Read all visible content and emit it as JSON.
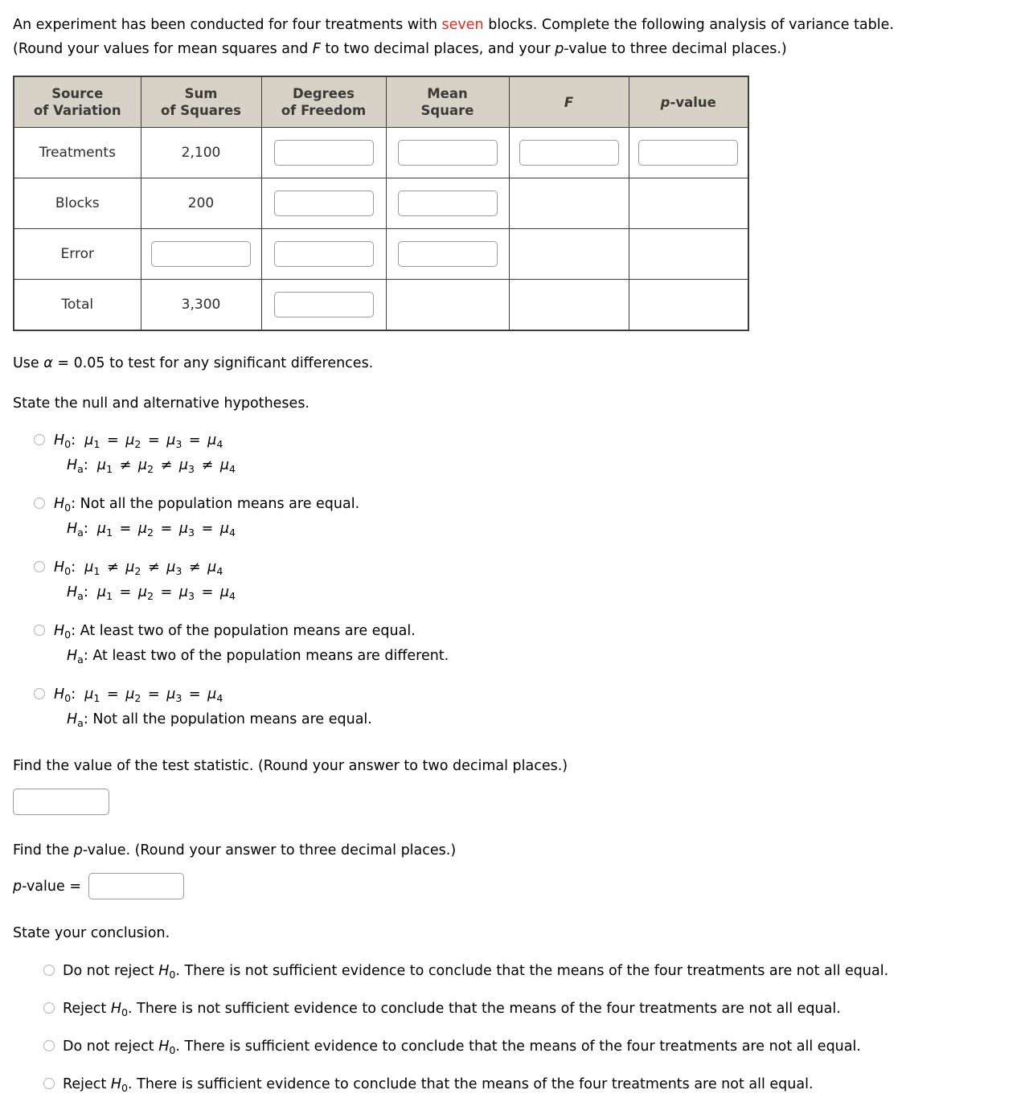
{
  "intro": {
    "part1": "An experiment has been conducted for four treatments with ",
    "highlight": "seven",
    "part2": " blocks. Complete the following analysis of variance table.",
    "line2_a": "(Round your values for mean squares and ",
    "line2_f": "F",
    "line2_b": " to two decimal places, and your ",
    "line2_p": "p",
    "line2_c": "-value to three decimal places.)"
  },
  "table": {
    "headers": {
      "source_l1": "Source",
      "source_l2": "of Variation",
      "ss_l1": "Sum",
      "ss_l2": "of Squares",
      "df_l1": "Degrees",
      "df_l2": "of Freedom",
      "ms_l1": "Mean",
      "ms_l2": "Square",
      "f": "F",
      "p_italic": "p",
      "p_rest": "-value"
    },
    "rows": [
      {
        "source": "Treatments",
        "sum_of_squares": "2,100"
      },
      {
        "source": "Blocks",
        "sum_of_squares": "200"
      },
      {
        "source": "Error",
        "sum_of_squares": ""
      },
      {
        "source": "Total",
        "sum_of_squares": "3,300"
      }
    ],
    "input_value": "",
    "input_placeholder": ""
  },
  "alpha_line": {
    "pre": "Use ",
    "alpha": "α",
    "post": " = 0.05 to test for any significant differences."
  },
  "state_hypotheses_label": "State the null and alternative hypotheses.",
  "hypothesis_options": [
    {
      "h0": {
        "name": "H",
        "sub": "0",
        "colon": ": ",
        "kind": "math",
        "text": "μ1 = μ2 = μ3 = μ4",
        "op": "="
      },
      "ha": {
        "name": "H",
        "sub": "a",
        "colon": ": ",
        "kind": "math",
        "text": "μ1 ≠ μ2 ≠ μ3 ≠ μ4",
        "op": "≠"
      }
    },
    {
      "h0": {
        "name": "H",
        "sub": "0",
        "colon": ": ",
        "kind": "text",
        "text": "Not all the population means are equal."
      },
      "ha": {
        "name": "H",
        "sub": "a",
        "colon": ": ",
        "kind": "math",
        "text": "μ1 = μ2 = μ3 = μ4",
        "op": "="
      }
    },
    {
      "h0": {
        "name": "H",
        "sub": "0",
        "colon": ": ",
        "kind": "math",
        "text": "μ1 ≠ μ2 ≠ μ3 ≠ μ4",
        "op": "≠"
      },
      "ha": {
        "name": "H",
        "sub": "a",
        "colon": ": ",
        "kind": "math",
        "text": "μ1 = μ2 = μ3 = μ4",
        "op": "="
      }
    },
    {
      "h0": {
        "name": "H",
        "sub": "0",
        "colon": ": ",
        "kind": "text",
        "text": "At least two of the population means are equal."
      },
      "ha": {
        "name": "H",
        "sub": "a",
        "colon": ": ",
        "kind": "text",
        "text": "At least two of the population means are different."
      }
    },
    {
      "h0": {
        "name": "H",
        "sub": "0",
        "colon": ": ",
        "kind": "math",
        "text": "μ1 = μ2 = μ3 = μ4",
        "op": "="
      },
      "ha": {
        "name": "H",
        "sub": "a",
        "colon": ": ",
        "kind": "text",
        "text": "Not all the population means are equal."
      }
    }
  ],
  "test_statistic": {
    "prompt": "Find the value of the test statistic. (Round your answer to two decimal places.)",
    "value": "",
    "placeholder": ""
  },
  "pvalue_section": {
    "prompt_a": "Find the ",
    "prompt_p": "p",
    "prompt_b": "-value. (Round your answer to three decimal places.)",
    "label_p": "p",
    "label_rest": "-value =",
    "value": "",
    "placeholder": ""
  },
  "conclusion_label": "State your conclusion.",
  "conclusion_options": [
    {
      "action": "Do not reject ",
      "h": "H",
      "sub": "0",
      "rest": ". There is not sufficient evidence to conclude that the means of the four treatments are not all equal."
    },
    {
      "action": "Reject ",
      "h": "H",
      "sub": "0",
      "rest": ". There is not sufficient evidence to conclude that the means of the four treatments are not all equal."
    },
    {
      "action": "Do not reject ",
      "h": "H",
      "sub": "0",
      "rest": ". There is sufficient evidence to conclude that the means of the four treatments are not all equal."
    },
    {
      "action": "Reject ",
      "h": "H",
      "sub": "0",
      "rest": ". There is sufficient evidence to conclude that the means of the four treatments are not all equal."
    }
  ],
  "colors": {
    "red_value": "#e8261a",
    "header_bg": "#d6d2c6",
    "border": "#3d3d3d"
  }
}
